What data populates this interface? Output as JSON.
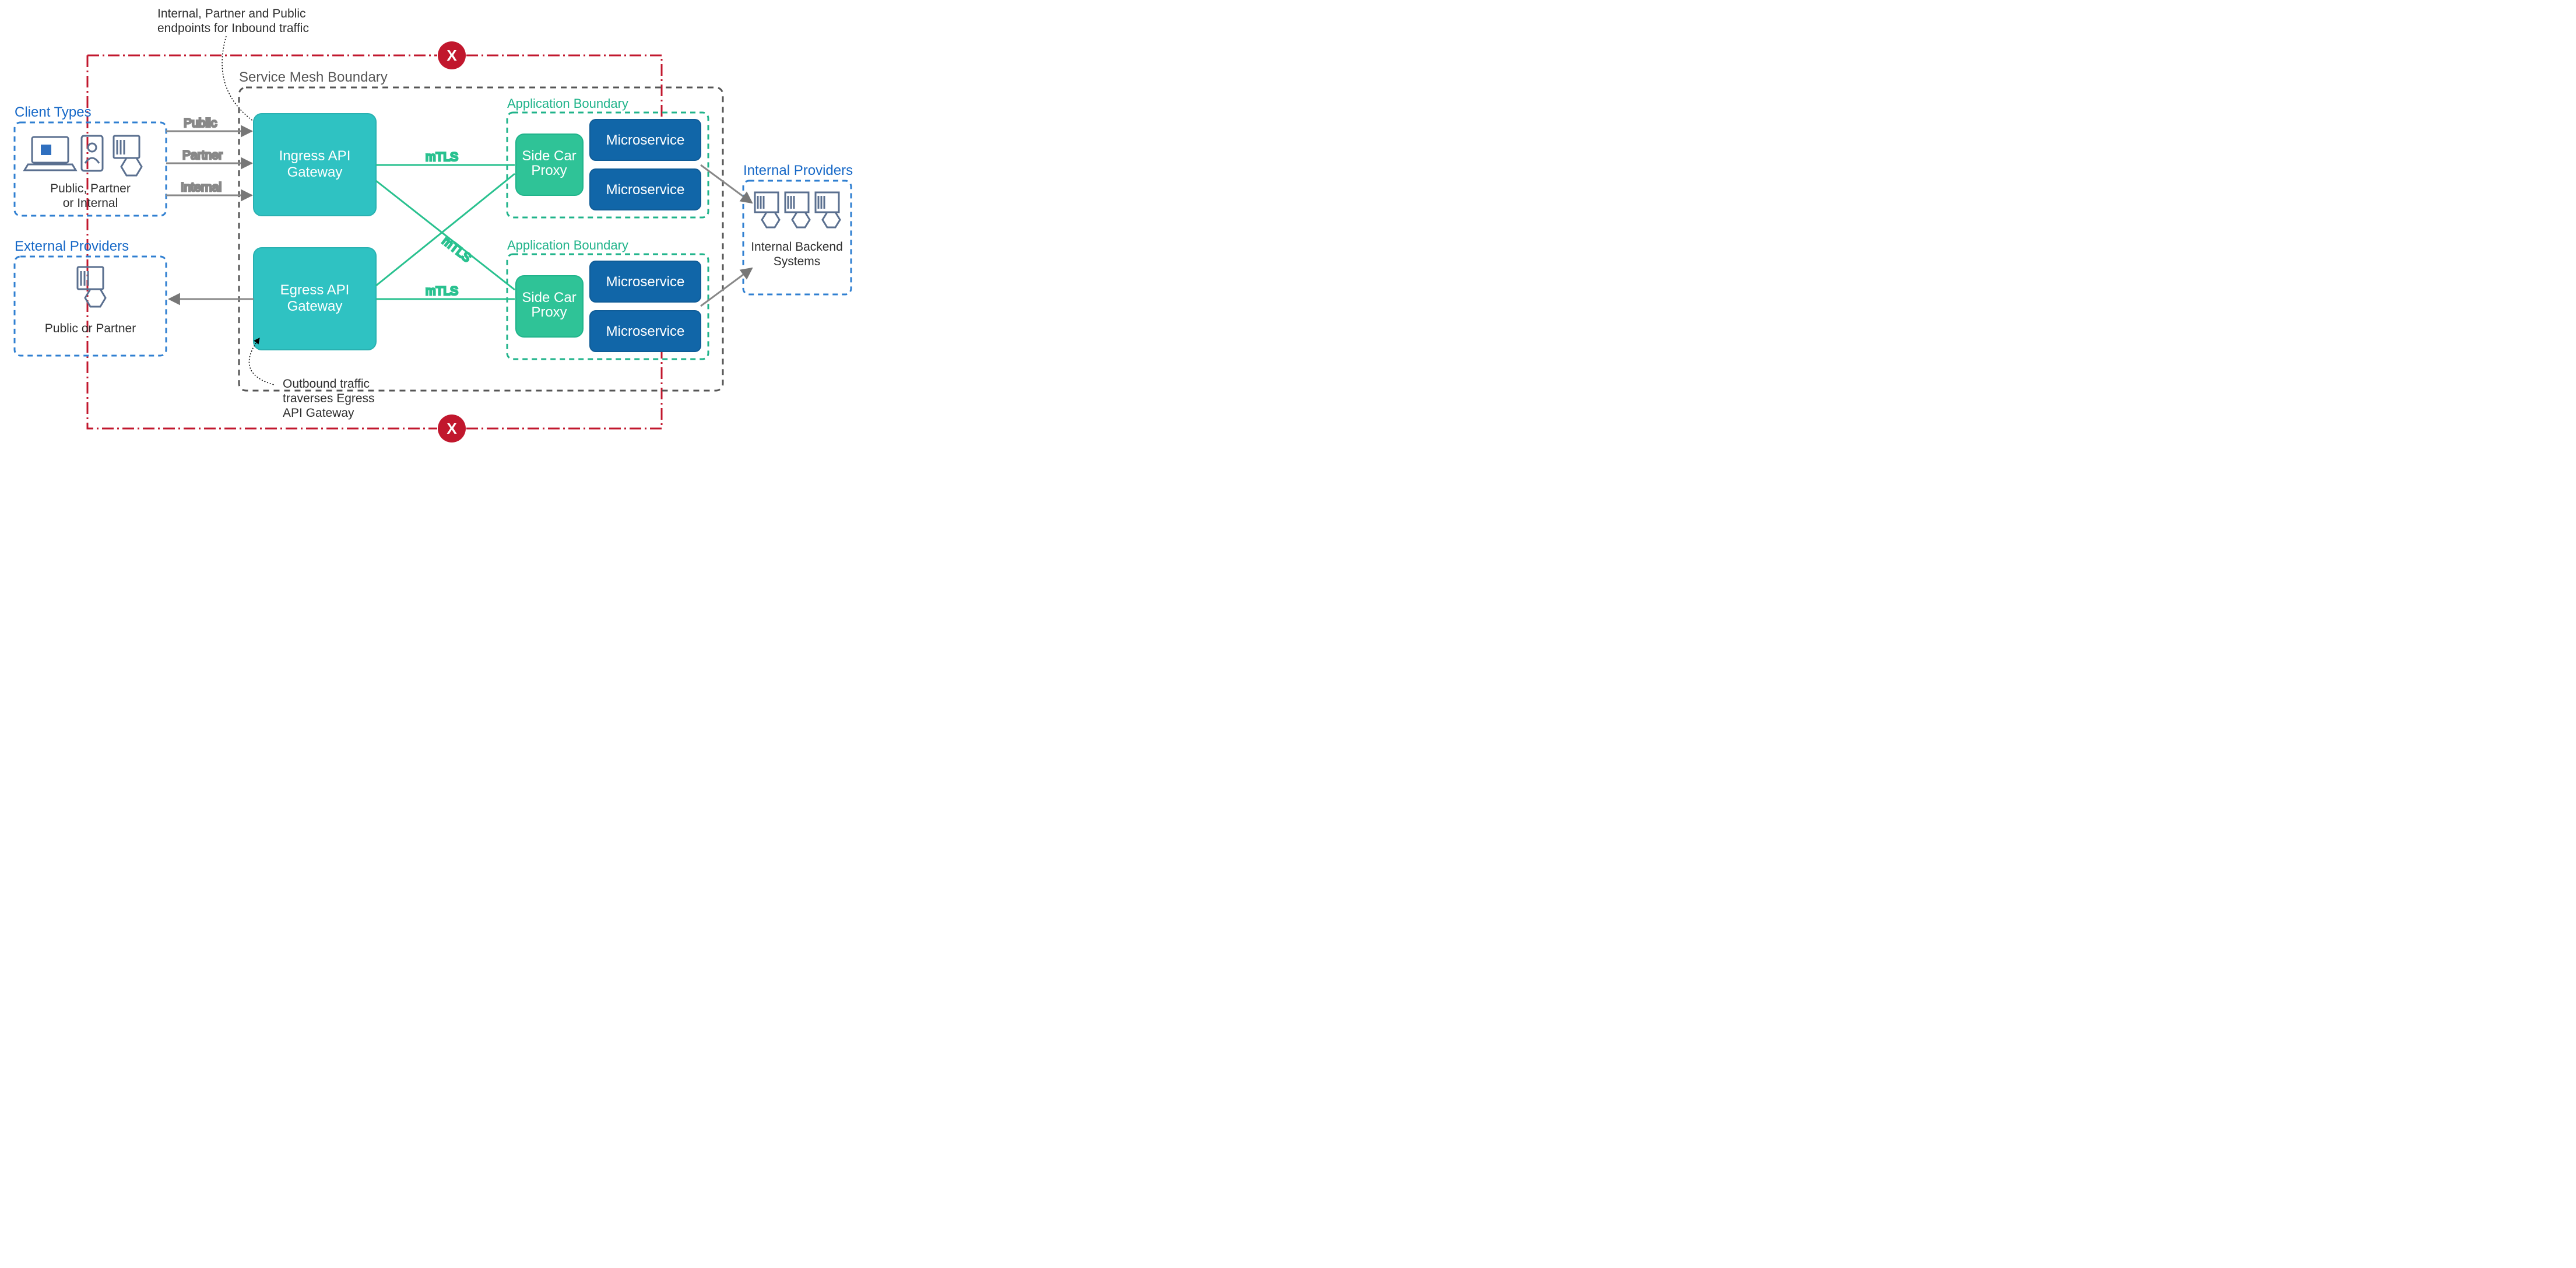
{
  "annotations": {
    "inbound": [
      "Internal, Partner and Public",
      "endpoints for Inbound traffic"
    ],
    "outbound": [
      "Outbound traffic",
      "traverses Egress",
      "API Gateway"
    ]
  },
  "clientTypes": {
    "title": "Client Types",
    "caption": [
      "Public, Partner",
      "or Internal"
    ]
  },
  "externalProviders": {
    "title": "External Providers",
    "caption": "Public or Partner"
  },
  "internalProviders": {
    "title": "Internal Providers",
    "caption": [
      "Internal Backend",
      "Systems"
    ]
  },
  "serviceMesh": {
    "title": "Service Mesh Boundary",
    "ingressGateway": [
      "Ingress API",
      "Gateway"
    ],
    "egressGateway": [
      "Egress API",
      "Gateway"
    ],
    "appBoundary": "Application Boundary",
    "sidecar": [
      "Side Car",
      "Proxy"
    ],
    "microservice": "Microservice"
  },
  "edgeLabels": {
    "public": "Public",
    "partner": "Partner",
    "internal": "Internal",
    "mtls": "mTLS"
  },
  "forbidden": "X",
  "colors": {
    "blue": "#1668c7",
    "blueDash": "#2f7fd1",
    "grey": "#777",
    "greyDark": "#555",
    "teal": "#2fc2c2",
    "tealDark": "#29b1b1",
    "green": "#1fb38a",
    "greenFill": "#2fc397",
    "msBlue": "#1166a8",
    "msBlueDark": "#0f5c97",
    "red": "#c1172d",
    "iconLine": "#5a6f8f",
    "iconFill": "#2f6fbf"
  }
}
